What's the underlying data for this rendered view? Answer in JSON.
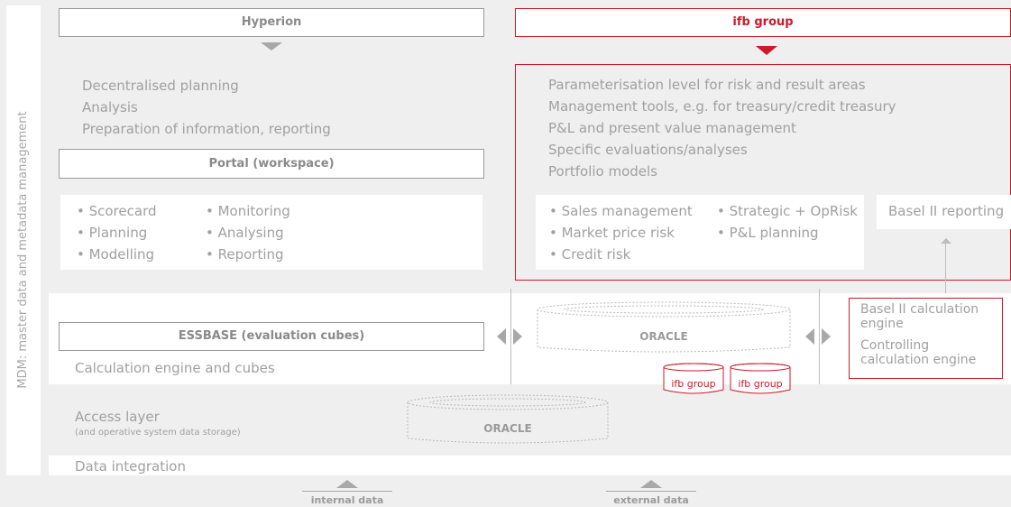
{
  "side_label": "MDM: master data and metadata management",
  "hyperion": {
    "title": "Hyperion",
    "functions": [
      "Decentralised planning",
      "Analysis",
      "Preparation of information, reporting"
    ],
    "portal": "Portal (workspace)",
    "col1": [
      "• Scorecard",
      "• Planning",
      "• Modelling"
    ],
    "col2": [
      "• Monitoring",
      "• Analysing",
      "• Reporting"
    ]
  },
  "ifb": {
    "title": "ifb group",
    "functions": [
      "Parameterisation level for risk and result areas",
      "Management tools, e.g. for treasury/credit treasury",
      "P&L and present value management",
      "Specific evaluations/analyses",
      "Portfolio models"
    ],
    "col1": [
      "• Sales management",
      "• Market price risk",
      "• Credit risk"
    ],
    "col2": [
      "• Strategic + OpRisk",
      "• P&L planning"
    ],
    "basel_reporting": "Basel II reporting"
  },
  "calc_layer": {
    "essbase": "ESSBASE (evaluation cubes)",
    "label": "Calculation engine and cubes",
    "oracle": "ORACLE",
    "cyl1": "ifb group",
    "cyl2": "ifb group",
    "basel_engine": "Basel II calculation engine",
    "controlling_engine": "Controlling calculation engine"
  },
  "access_layer": {
    "label": "Access layer",
    "sub": "(and operative system data storage)",
    "oracle": "ORACLE"
  },
  "data_integration": "Data integration",
  "inputs": {
    "internal": "internal data",
    "external": "external data"
  },
  "colors": {
    "accent": "#cc1a2a",
    "gray": "#9a9a9a",
    "background": "#efefef"
  }
}
